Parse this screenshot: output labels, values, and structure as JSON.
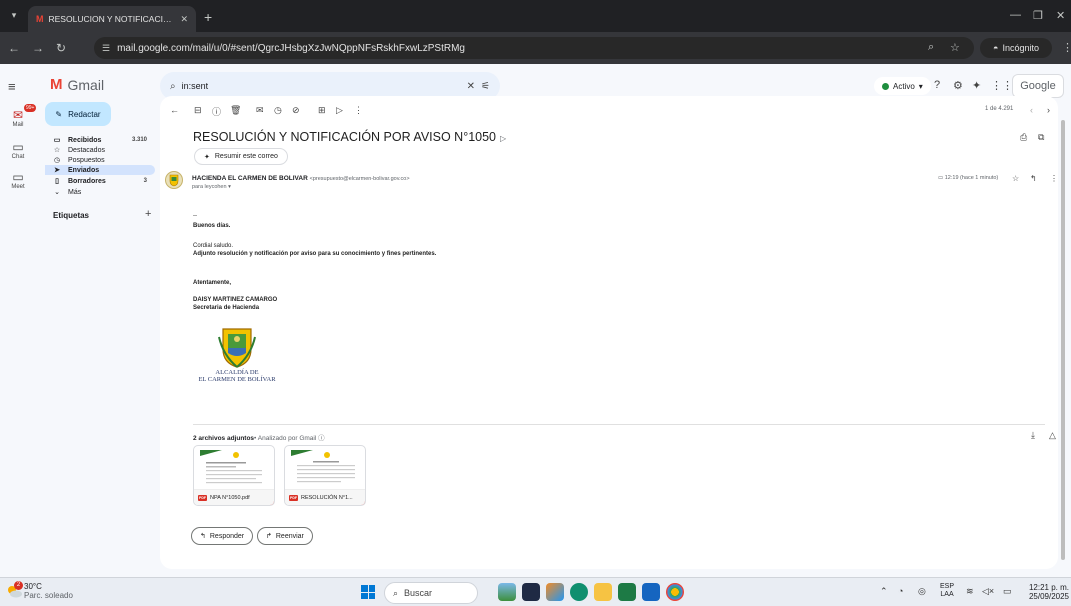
{
  "browser": {
    "tab_title": "RESOLUCION Y NOTIFICACION",
    "url": "mail.google.com/mail/u/0/#sent/QgrcJHsbgXzJwNQppNFsRskhFxwLzPStRMg",
    "incognito_label": "Incógnito"
  },
  "gmail": {
    "app_name": "Gmail",
    "search_value": "in:sent",
    "status_label": "Activo",
    "account_label": "Google"
  },
  "rail": {
    "mail": "Mail",
    "mail_badge": "99+",
    "chat": "Chat",
    "meet": "Meet"
  },
  "nav": {
    "compose": "Redactar",
    "items": [
      {
        "label": "Recibidos",
        "count": "3.310",
        "icon": "inbox-icon"
      },
      {
        "label": "Destacados",
        "count": "",
        "icon": "star-icon"
      },
      {
        "label": "Pospuestos",
        "count": "",
        "icon": "clock-icon"
      },
      {
        "label": "Enviados",
        "count": "",
        "icon": "send-icon"
      },
      {
        "label": "Borradores",
        "count": "3",
        "icon": "draft-icon"
      },
      {
        "label": "Más",
        "count": "",
        "icon": "chevron-down-icon"
      }
    ],
    "labels_heading": "Etiquetas"
  },
  "message": {
    "paging": "1 de 4.291",
    "subject": "RESOLUCIÓN Y NOTIFICACIÓN POR AVISO N°1050",
    "summarize": "Resumir este correo",
    "sender_name": "HACIENDA EL CARMEN DE BOLIVAR",
    "sender_email": "<presupuesto@elcarmen-bolivar.gov.co>",
    "to": "para leycohen",
    "time": "12:19 (hace 1 minuto)",
    "body": {
      "dash": "--",
      "greeting": "Buenos días.",
      "salute": "Cordial saludo.",
      "line1": "Adjunto resolución y notificación por aviso para su conocimiento y fines pertinentes.",
      "closing": "Atentamente,",
      "sig_name": "DAISY MARTINEZ CAMARGO",
      "sig_title": "Secretaria de Hacienda",
      "crest_line1": "ALCALDÍA DE",
      "crest_line2": "EL CARMEN DE BOLÍVAR"
    },
    "attachments_title": "2 archivos adjuntos",
    "attachments_scan": "• Analizado por Gmail",
    "attachments": [
      {
        "name": "NPA N°1050.pdf",
        "type": "PDF"
      },
      {
        "name": "RESOLUCIÓN N°1...",
        "type": "PDF"
      }
    ],
    "reply": "Responder",
    "forward": "Reenviar"
  },
  "taskbar": {
    "temp": "30°C",
    "weather": "Parc. soleado",
    "weather_badge": "2",
    "search": "Buscar",
    "lang1": "ESP",
    "lang2": "LAA",
    "time": "12:21 p. m.",
    "date": "25/09/2025"
  },
  "colors": {
    "gmail_red": "#ea4335",
    "compose_bg": "#c2e7ff",
    "active_nav": "#d3e3fd",
    "active_dot": "#1e8e3e"
  }
}
